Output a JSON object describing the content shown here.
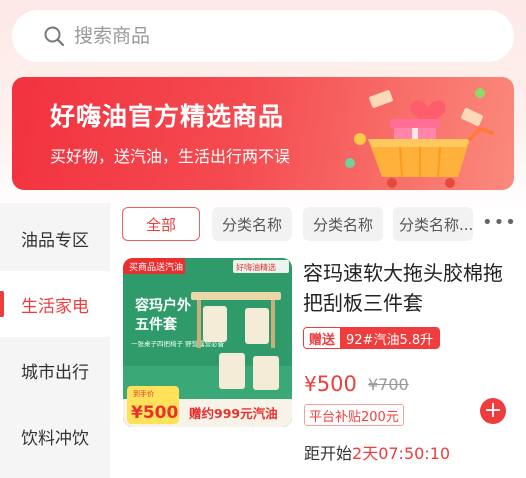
{
  "search": {
    "placeholder": "搜索商品"
  },
  "banner": {
    "title": "好嗨油官方精选商品",
    "subtitle": "买好物，送汽油，生活出行两不误"
  },
  "sidebar": {
    "items": [
      {
        "label": "油品专区",
        "active": false
      },
      {
        "label": "生活家电",
        "active": true
      },
      {
        "label": "城市出行",
        "active": false
      },
      {
        "label": "饮料冲饮",
        "active": false
      }
    ]
  },
  "tabs": [
    {
      "label": "全部",
      "active": true
    },
    {
      "label": "分类名称",
      "active": false
    },
    {
      "label": "分类名称",
      "active": false
    },
    {
      "label": "分类名称...",
      "active": false
    }
  ],
  "more_label": "•••",
  "product": {
    "image": {
      "brand_tag": "买商品送汽油",
      "brand_logo_text": "好嗨油精选",
      "headline_line1": "容玛户外",
      "headline_line2": "五件套",
      "tagline": "一张桌子四把椅子  野营露营必备",
      "price_tag_label": "到手价",
      "price_tag_value": "¥500",
      "gift_strip": "赠约999元汽油"
    },
    "title": "容玛速软大拖头胶棉拖把刮板三件套",
    "gift_label": "赠送",
    "gift_value": "92#汽油5.8升",
    "currency": "¥",
    "price": "500",
    "original_price": "¥700",
    "subsidy": "平台补贴200元",
    "add_symbol": "+",
    "countdown_label": "距开始",
    "countdown_time": "2天07:50:10"
  },
  "colors": {
    "accent": "#ef3d3d",
    "banner_start": "#f2323f",
    "banner_end": "#fb8a7c",
    "product_green": "#2f9b6a"
  }
}
